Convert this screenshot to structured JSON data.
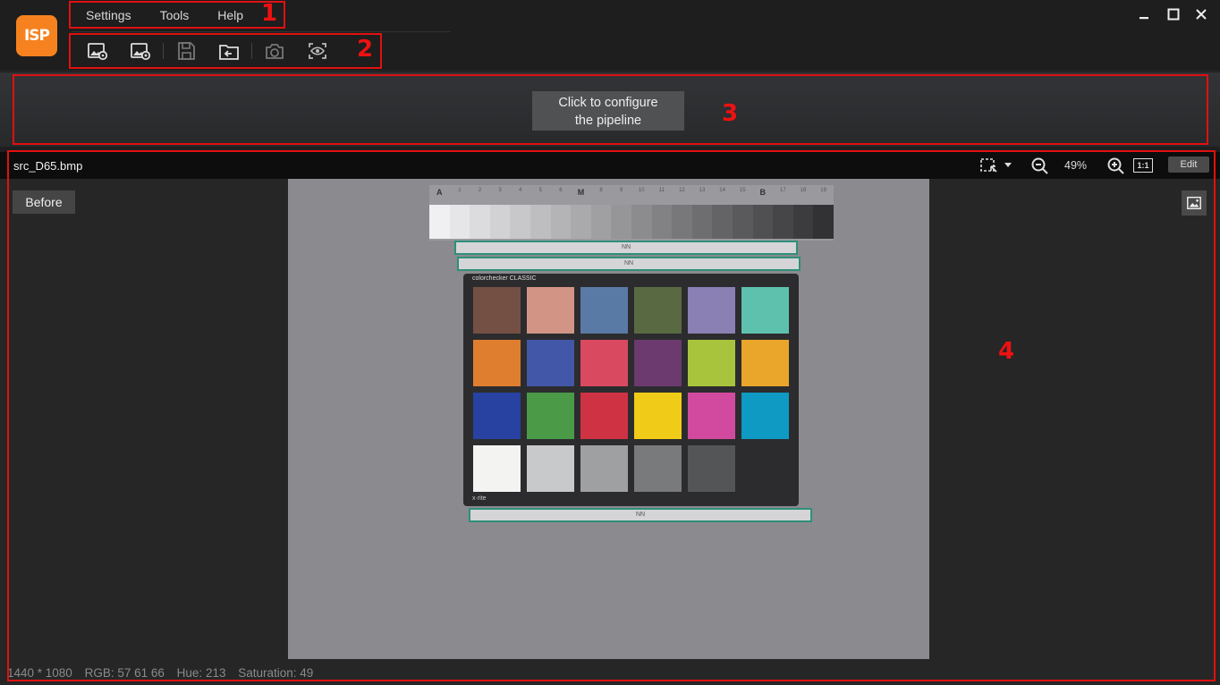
{
  "app": {
    "logo_text": "ISP",
    "brand_color": "#f5821f"
  },
  "menu": {
    "items": [
      "Settings",
      "Tools",
      "Help"
    ]
  },
  "toolbar": {
    "buttons": [
      {
        "name": "open-image-settings-button",
        "icon": "image-gear-icon"
      },
      {
        "name": "import-image-button",
        "icon": "image-add-icon"
      },
      {
        "name": "save-button",
        "icon": "save-icon"
      },
      {
        "name": "export-button",
        "icon": "export-icon"
      },
      {
        "name": "capture-button",
        "icon": "camera-icon"
      },
      {
        "name": "preview-button",
        "icon": "eye-scan-icon"
      }
    ]
  },
  "annotations": {
    "menu": "1",
    "toolbar": "2",
    "pipeline": "3",
    "viewer": "4",
    "color": "#e01010"
  },
  "pipeline": {
    "button_line1": "Click to configure",
    "button_line2": "the pipeline"
  },
  "viewer": {
    "file_name": "src_D65.bmp",
    "zoom": "49%",
    "one_to_one": "1:1",
    "edit_label": "Edit",
    "before_label": "Before"
  },
  "status": {
    "dimensions": "1440 * 1080",
    "rgb": "RGB: 57 61 66",
    "hue": "Hue: 213",
    "saturation": "Saturation: 49"
  },
  "image": {
    "grey_labels": [
      "A",
      "1",
      "2",
      "3",
      "4",
      "5",
      "6",
      "M",
      "8",
      "9",
      "10",
      "11",
      "12",
      "13",
      "14",
      "15",
      "B",
      "17",
      "18",
      "19"
    ],
    "tag_text": "NN",
    "checker_logo": "colorchecker CLASSIC",
    "checker_footer": "x·rite",
    "patch_colors": [
      "#745044",
      "#d29585",
      "#5a7aa6",
      "#596a43",
      "#8a80b4",
      "#5ec1ae",
      "#e07e30",
      "#4357a8",
      "#d94a60",
      "#6c3a6e",
      "#a8c43c",
      "#eaa62a",
      "#2742a0",
      "#4a9a48",
      "#cf3243",
      "#f0cc18",
      "#d24a9f",
      "#0e9ac3",
      "#f3f3f1",
      "#c8c9ca",
      "#9ea0a1",
      "#797a7b",
      "#545556",
      "#2c2c2e"
    ]
  }
}
